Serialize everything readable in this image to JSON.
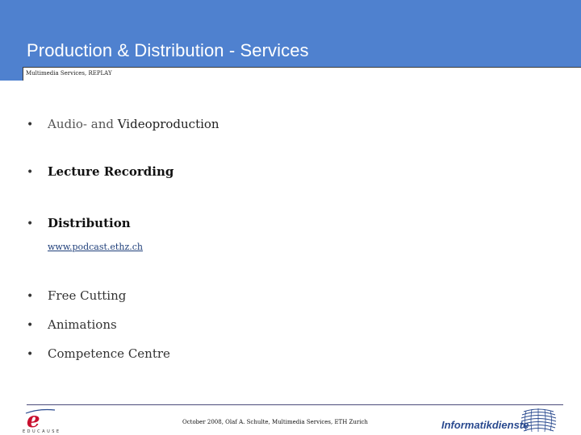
{
  "slide": {
    "title": "Production & Distribution - Services",
    "subtitle": "Multimedia Services, REPLAY"
  },
  "bullets": [
    {
      "bullet": "•",
      "text_light": "Audio- and ",
      "text_dark": "Videoproduction",
      "bold": false
    },
    {
      "bullet": "•",
      "text": "Lecture Recording",
      "bold": true
    },
    {
      "bullet": "•",
      "text": "Distribution",
      "bold": true
    },
    {
      "bullet": "•",
      "text": "Free Cutting",
      "bold": false
    },
    {
      "bullet": "•",
      "text": "Animations",
      "bold": false
    },
    {
      "bullet": "•",
      "text": "Competence Centre",
      "bold": false
    }
  ],
  "link": {
    "text": "www.podcast.ethz.ch"
  },
  "footer": {
    "text": "October 2008, Olaf A. Schulte, Multimedia Services, ETH Zurich",
    "left_logo": {
      "letter": "e",
      "caption": "EDUCAUSE"
    },
    "right_logo": {
      "text": "Informatikdienste"
    }
  },
  "colors": {
    "header_blue": "#4f81cf",
    "logo_red": "#c8102e",
    "logo_blue": "#2a4a8f"
  }
}
